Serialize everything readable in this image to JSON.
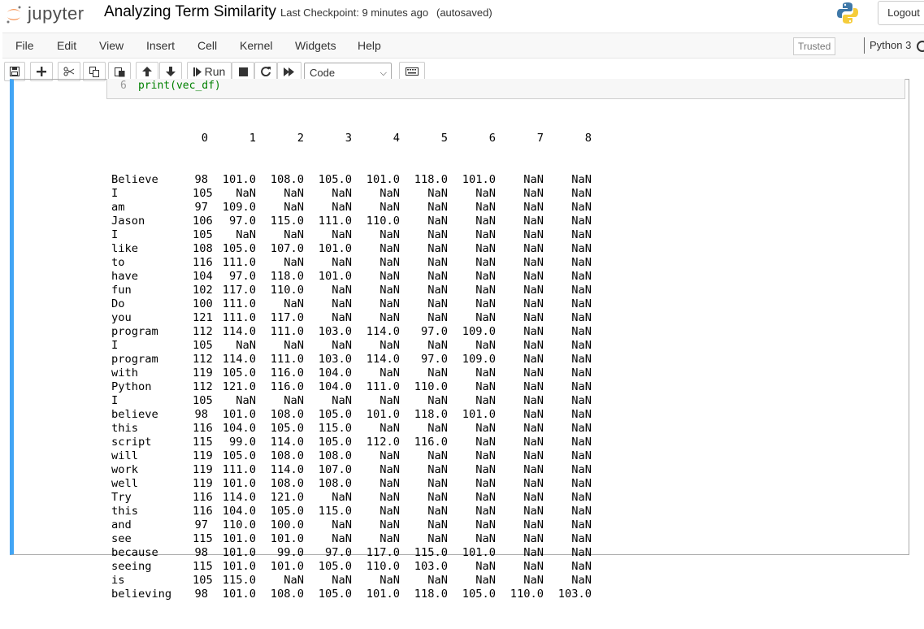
{
  "header": {
    "logo_text": "jupyter",
    "notebook_title": "Analyzing Term Similarity",
    "checkpoint": "Last Checkpoint: 9 minutes ago",
    "autosave": "(autosaved)",
    "logout_label": "Logout"
  },
  "menubar": {
    "items": [
      "File",
      "Edit",
      "View",
      "Insert",
      "Cell",
      "Kernel",
      "Widgets",
      "Help"
    ],
    "trusted_label": "Trusted",
    "kernel_name": "Python 3"
  },
  "toolbar": {
    "run_label": "Run",
    "cell_type": "Code",
    "icons": [
      "save-icon",
      "plus-icon",
      "scissors-icon",
      "copy-icon",
      "paste-icon",
      "arrow-up-icon",
      "arrow-down-icon",
      "step-forward-icon",
      "stop-icon",
      "restart-icon",
      "fast-forward-icon",
      "keyboard-icon"
    ]
  },
  "cell": {
    "line_number": "6",
    "code": "print(vec_df)"
  },
  "output": {
    "columns": [
      "0",
      "1",
      "2",
      "3",
      "4",
      "5",
      "6",
      "7",
      "8"
    ],
    "rows": [
      {
        "label": "Believe",
        "values": [
          "98",
          "101.0",
          "108.0",
          "105.0",
          "101.0",
          "118.0",
          "101.0",
          "NaN",
          "NaN"
        ]
      },
      {
        "label": "I",
        "values": [
          "105",
          "NaN",
          "NaN",
          "NaN",
          "NaN",
          "NaN",
          "NaN",
          "NaN",
          "NaN"
        ]
      },
      {
        "label": "am",
        "values": [
          "97",
          "109.0",
          "NaN",
          "NaN",
          "NaN",
          "NaN",
          "NaN",
          "NaN",
          "NaN"
        ]
      },
      {
        "label": "Jason",
        "values": [
          "106",
          "97.0",
          "115.0",
          "111.0",
          "110.0",
          "NaN",
          "NaN",
          "NaN",
          "NaN"
        ]
      },
      {
        "label": "I",
        "values": [
          "105",
          "NaN",
          "NaN",
          "NaN",
          "NaN",
          "NaN",
          "NaN",
          "NaN",
          "NaN"
        ]
      },
      {
        "label": "like",
        "values": [
          "108",
          "105.0",
          "107.0",
          "101.0",
          "NaN",
          "NaN",
          "NaN",
          "NaN",
          "NaN"
        ]
      },
      {
        "label": "to",
        "values": [
          "116",
          "111.0",
          "NaN",
          "NaN",
          "NaN",
          "NaN",
          "NaN",
          "NaN",
          "NaN"
        ]
      },
      {
        "label": "have",
        "values": [
          "104",
          "97.0",
          "118.0",
          "101.0",
          "NaN",
          "NaN",
          "NaN",
          "NaN",
          "NaN"
        ]
      },
      {
        "label": "fun",
        "values": [
          "102",
          "117.0",
          "110.0",
          "NaN",
          "NaN",
          "NaN",
          "NaN",
          "NaN",
          "NaN"
        ]
      },
      {
        "label": "Do",
        "values": [
          "100",
          "111.0",
          "NaN",
          "NaN",
          "NaN",
          "NaN",
          "NaN",
          "NaN",
          "NaN"
        ]
      },
      {
        "label": "you",
        "values": [
          "121",
          "111.0",
          "117.0",
          "NaN",
          "NaN",
          "NaN",
          "NaN",
          "NaN",
          "NaN"
        ]
      },
      {
        "label": "program",
        "values": [
          "112",
          "114.0",
          "111.0",
          "103.0",
          "114.0",
          "97.0",
          "109.0",
          "NaN",
          "NaN"
        ]
      },
      {
        "label": "I",
        "values": [
          "105",
          "NaN",
          "NaN",
          "NaN",
          "NaN",
          "NaN",
          "NaN",
          "NaN",
          "NaN"
        ]
      },
      {
        "label": "program",
        "values": [
          "112",
          "114.0",
          "111.0",
          "103.0",
          "114.0",
          "97.0",
          "109.0",
          "NaN",
          "NaN"
        ]
      },
      {
        "label": "with",
        "values": [
          "119",
          "105.0",
          "116.0",
          "104.0",
          "NaN",
          "NaN",
          "NaN",
          "NaN",
          "NaN"
        ]
      },
      {
        "label": "Python",
        "values": [
          "112",
          "121.0",
          "116.0",
          "104.0",
          "111.0",
          "110.0",
          "NaN",
          "NaN",
          "NaN"
        ]
      },
      {
        "label": "I",
        "values": [
          "105",
          "NaN",
          "NaN",
          "NaN",
          "NaN",
          "NaN",
          "NaN",
          "NaN",
          "NaN"
        ]
      },
      {
        "label": "believe",
        "values": [
          "98",
          "101.0",
          "108.0",
          "105.0",
          "101.0",
          "118.0",
          "101.0",
          "NaN",
          "NaN"
        ]
      },
      {
        "label": "this",
        "values": [
          "116",
          "104.0",
          "105.0",
          "115.0",
          "NaN",
          "NaN",
          "NaN",
          "NaN",
          "NaN"
        ]
      },
      {
        "label": "script",
        "values": [
          "115",
          "99.0",
          "114.0",
          "105.0",
          "112.0",
          "116.0",
          "NaN",
          "NaN",
          "NaN"
        ]
      },
      {
        "label": "will",
        "values": [
          "119",
          "105.0",
          "108.0",
          "108.0",
          "NaN",
          "NaN",
          "NaN",
          "NaN",
          "NaN"
        ]
      },
      {
        "label": "work",
        "values": [
          "119",
          "111.0",
          "114.0",
          "107.0",
          "NaN",
          "NaN",
          "NaN",
          "NaN",
          "NaN"
        ]
      },
      {
        "label": "well",
        "values": [
          "119",
          "101.0",
          "108.0",
          "108.0",
          "NaN",
          "NaN",
          "NaN",
          "NaN",
          "NaN"
        ]
      },
      {
        "label": "Try",
        "values": [
          "116",
          "114.0",
          "121.0",
          "NaN",
          "NaN",
          "NaN",
          "NaN",
          "NaN",
          "NaN"
        ]
      },
      {
        "label": "this",
        "values": [
          "116",
          "104.0",
          "105.0",
          "115.0",
          "NaN",
          "NaN",
          "NaN",
          "NaN",
          "NaN"
        ]
      },
      {
        "label": "and",
        "values": [
          "97",
          "110.0",
          "100.0",
          "NaN",
          "NaN",
          "NaN",
          "NaN",
          "NaN",
          "NaN"
        ]
      },
      {
        "label": "see",
        "values": [
          "115",
          "101.0",
          "101.0",
          "NaN",
          "NaN",
          "NaN",
          "NaN",
          "NaN",
          "NaN"
        ]
      },
      {
        "label": "because",
        "values": [
          "98",
          "101.0",
          "99.0",
          "97.0",
          "117.0",
          "115.0",
          "101.0",
          "NaN",
          "NaN"
        ]
      },
      {
        "label": "seeing",
        "values": [
          "115",
          "101.0",
          "101.0",
          "105.0",
          "110.0",
          "103.0",
          "NaN",
          "NaN",
          "NaN"
        ]
      },
      {
        "label": "is",
        "values": [
          "105",
          "115.0",
          "NaN",
          "NaN",
          "NaN",
          "NaN",
          "NaN",
          "NaN",
          "NaN"
        ]
      },
      {
        "label": "believing",
        "values": [
          "98",
          "101.0",
          "108.0",
          "105.0",
          "101.0",
          "118.0",
          "105.0",
          "110.0",
          "103.0"
        ]
      }
    ]
  },
  "colors": {
    "cell_accent": "#42a5f5",
    "code_green": "#008000",
    "logo_orange": "#f37726"
  }
}
